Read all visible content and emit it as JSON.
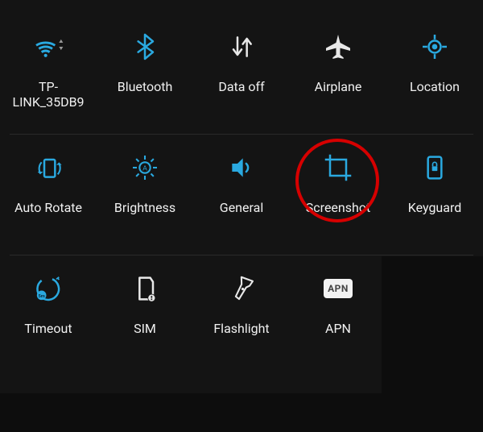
{
  "colors": {
    "accent": "#2aa9e0",
    "foreground": "#e8e8e8",
    "highlight": "#d60000"
  },
  "tiles": [
    {
      "id": "wifi",
      "label": "TP-LINK_35DB9",
      "icon": "wifi-icon",
      "active": true
    },
    {
      "id": "bluetooth",
      "label": "Bluetooth",
      "icon": "bluetooth-icon",
      "active": true
    },
    {
      "id": "data",
      "label": "Data off",
      "icon": "data-off-icon",
      "active": false
    },
    {
      "id": "airplane",
      "label": "Airplane",
      "icon": "airplane-icon",
      "active": false
    },
    {
      "id": "location",
      "label": "Location",
      "icon": "location-icon",
      "active": true
    },
    {
      "id": "rotate",
      "label": "Auto Rotate",
      "icon": "auto-rotate-icon",
      "active": true
    },
    {
      "id": "brightness",
      "label": "Brightness",
      "icon": "brightness-icon",
      "active": true
    },
    {
      "id": "sound",
      "label": "General",
      "icon": "sound-icon",
      "active": true
    },
    {
      "id": "screenshot",
      "label": "Screenshot",
      "icon": "screenshot-icon",
      "active": true
    },
    {
      "id": "keyguard",
      "label": "Keyguard",
      "icon": "keyguard-icon",
      "active": true
    },
    {
      "id": "timeout",
      "label": "Timeout",
      "icon": "timeout-icon",
      "active": true
    },
    {
      "id": "sim",
      "label": "SIM",
      "icon": "sim-icon",
      "active": false
    },
    {
      "id": "flashlight",
      "label": "Flashlight",
      "icon": "flashlight-icon",
      "active": false
    },
    {
      "id": "apn",
      "label": "APN",
      "icon": "apn-icon",
      "active": false,
      "badge": "APN"
    }
  ],
  "highlighted_tile": "screenshot"
}
